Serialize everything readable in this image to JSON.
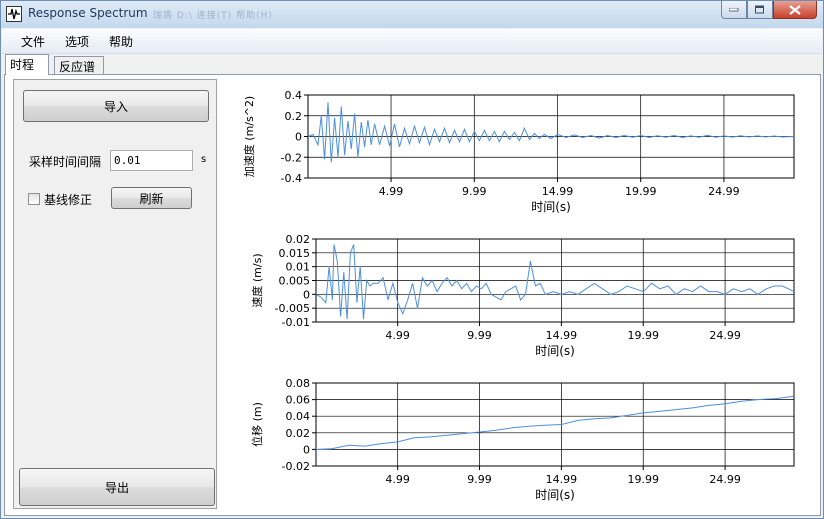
{
  "window": {
    "title": "Response Spectrum",
    "ghost_title": "瑞盾 D:\\  连接(T)  帮助(H)"
  },
  "menu": [
    "文件",
    "选项",
    "帮助"
  ],
  "tabs": [
    "时程",
    "反应谱"
  ],
  "left_panel": {
    "import_button": "导入",
    "interval_label": "采样时间间隔",
    "interval_value": "0.01",
    "interval_unit": "s",
    "baseline_label": "基线修正",
    "baseline_checked": false,
    "refresh_button": "刷新",
    "export_button": "导出"
  },
  "colors": {
    "series": "#4d8fdf",
    "grid": "#000000"
  },
  "chart_data": [
    {
      "type": "line",
      "ylabel": "加速度 (m/s^2)",
      "xlabel": "时间(s)",
      "xlim": [
        0,
        29.2
      ],
      "ylim": [
        -0.4,
        0.4
      ],
      "yticks": [
        -0.4,
        -0.2,
        0,
        0.2,
        0.4
      ],
      "ytick_labels": [
        "-0.4",
        "-0.2",
        "0",
        "0.2",
        "0.4"
      ],
      "xticks": [
        4.99,
        9.99,
        14.99,
        19.99,
        24.99
      ],
      "xtick_labels": [
        "4.99",
        "9.99",
        "14.99",
        "19.99",
        "24.99"
      ],
      "series": [
        {
          "x": [
            0,
            0.3,
            0.6,
            0.8,
            1.0,
            1.2,
            1.4,
            1.6,
            1.8,
            2.0,
            2.2,
            2.4,
            2.6,
            2.8,
            3.0,
            3.2,
            3.4,
            3.6,
            3.8,
            4.0,
            4.3,
            4.6,
            4.9,
            5.2,
            5.5,
            5.8,
            6.1,
            6.4,
            6.7,
            7.0,
            7.3,
            7.6,
            7.9,
            8.2,
            8.5,
            8.8,
            9.1,
            9.4,
            9.7,
            10.0,
            10.3,
            10.6,
            10.9,
            11.2,
            11.5,
            11.8,
            12.1,
            12.4,
            12.7,
            13.0,
            13.3,
            13.6,
            13.9,
            14.2,
            14.6,
            15.0,
            15.5,
            16.0,
            16.5,
            17.0,
            17.5,
            18.0,
            18.5,
            19.0,
            19.5,
            20.0,
            20.5,
            21.0,
            21.5,
            22.0,
            22.5,
            23.0,
            23.5,
            24.0,
            24.5,
            25.0,
            25.5,
            26.0,
            26.5,
            27.0,
            27.5,
            28.0,
            28.5,
            29.2
          ],
          "y": [
            0,
            0.02,
            -0.08,
            0.2,
            -0.22,
            0.33,
            -0.25,
            0.18,
            -0.2,
            0.29,
            -0.18,
            0.15,
            -0.12,
            0.22,
            -0.2,
            0.14,
            -0.1,
            0.16,
            -0.08,
            0.12,
            -0.08,
            0.1,
            -0.09,
            0.12,
            -0.1,
            0.08,
            -0.07,
            0.1,
            -0.06,
            0.09,
            -0.08,
            0.07,
            -0.05,
            0.08,
            -0.06,
            0.06,
            -0.05,
            0.07,
            -0.05,
            0.05,
            -0.04,
            0.06,
            -0.04,
            0.05,
            -0.05,
            0.05,
            -0.03,
            0.04,
            -0.04,
            0.08,
            -0.03,
            0.03,
            -0.02,
            0.02,
            -0.02,
            0.02,
            -0.01,
            0.015,
            -0.01,
            0.01,
            -0.015,
            0.01,
            -0.01,
            0.01,
            -0.008,
            0.01,
            -0.01,
            0.008,
            -0.008,
            0.01,
            -0.01,
            0.006,
            -0.008,
            0.012,
            -0.008,
            0.006,
            -0.006,
            0.008,
            -0.005,
            0.006,
            -0.005,
            0.005,
            -0.005,
            0
          ]
        }
      ]
    },
    {
      "type": "line",
      "ylabel": "速度 (m/s)",
      "xlabel": "时间(s)",
      "xlim": [
        0,
        29.2
      ],
      "ylim": [
        -0.01,
        0.02
      ],
      "yticks": [
        -0.01,
        -0.005,
        0,
        0.005,
        0.01,
        0.015,
        0.02
      ],
      "ytick_labels": [
        "-0.01",
        "-0.005",
        "0",
        "0.005",
        "0.01",
        "0.015",
        "0.02"
      ],
      "xticks": [
        4.99,
        9.99,
        14.99,
        19.99,
        24.99
      ],
      "xtick_labels": [
        "4.99",
        "9.99",
        "14.99",
        "19.99",
        "24.99"
      ],
      "series": [
        {
          "x": [
            0,
            0.3,
            0.6,
            0.8,
            1.0,
            1.1,
            1.3,
            1.5,
            1.7,
            1.9,
            2.1,
            2.3,
            2.5,
            2.7,
            2.9,
            3.1,
            3.3,
            3.5,
            3.8,
            4.1,
            4.4,
            4.7,
            5.0,
            5.3,
            5.6,
            5.9,
            6.2,
            6.5,
            6.8,
            7.1,
            7.4,
            7.7,
            8.0,
            8.3,
            8.6,
            8.9,
            9.2,
            9.5,
            9.8,
            10.1,
            10.4,
            10.7,
            11.0,
            11.3,
            11.6,
            11.9,
            12.2,
            12.5,
            12.8,
            13.1,
            13.4,
            13.7,
            14.0,
            14.5,
            15.0,
            15.5,
            16.0,
            16.5,
            17.0,
            17.5,
            18.0,
            18.5,
            19.0,
            19.5,
            20.0,
            20.5,
            21.0,
            21.5,
            22.0,
            22.5,
            23.0,
            23.5,
            24.0,
            24.5,
            25.0,
            25.5,
            26.0,
            26.5,
            27.0,
            27.5,
            28.0,
            28.5,
            29.2
          ],
          "y": [
            0,
            -0.001,
            -0.003,
            0.01,
            -0.002,
            0.018,
            0.012,
            -0.008,
            0.008,
            -0.009,
            0.015,
            0.018,
            -0.003,
            0.01,
            -0.009,
            0.005,
            0.003,
            0.004,
            0.004,
            0.006,
            -0.002,
            0.004,
            -0.003,
            -0.007,
            -0.002,
            0.004,
            -0.005,
            0.006,
            0.003,
            0.005,
            0.001,
            0.004,
            0.006,
            0.003,
            0.005,
            0.002,
            0.004,
            0.001,
            0.003,
            0.002,
            0.004,
            0.0,
            -0.001,
            -0.002,
            0.001,
            0.002,
            0.003,
            -0.002,
            0.0,
            0.012,
            0.003,
            0.004,
            0.0,
            0.001,
            0.0,
            0.001,
            0.0,
            0.002,
            0.004,
            0.002,
            0.0,
            0.001,
            0.003,
            0.002,
            0.001,
            0.004,
            0.002,
            0.003,
            0.0,
            0.002,
            0.001,
            0.003,
            0.001,
            0.001,
            0.0,
            0.002,
            0.001,
            0.002,
            0.0,
            0.002,
            0.003,
            0.003,
            0.001
          ]
        }
      ]
    },
    {
      "type": "line",
      "ylabel": "位移 (m)",
      "xlabel": "时间(s)",
      "xlim": [
        0,
        29.2
      ],
      "ylim": [
        -0.02,
        0.08
      ],
      "yticks": [
        -0.02,
        0,
        0.02,
        0.04,
        0.06,
        0.08
      ],
      "ytick_labels": [
        "-0.02",
        "0",
        "0.02",
        "0.04",
        "0.06",
        "0.08"
      ],
      "xticks": [
        4.99,
        9.99,
        14.99,
        19.99,
        24.99
      ],
      "xtick_labels": [
        "4.99",
        "9.99",
        "14.99",
        "19.99",
        "24.99"
      ],
      "series": [
        {
          "x": [
            0,
            1,
            2,
            3,
            4,
            5,
            6,
            7,
            8,
            9,
            10,
            11,
            12,
            13,
            14,
            15,
            16,
            17,
            18,
            19,
            20,
            21,
            22,
            23,
            24,
            25,
            26,
            27,
            28,
            29.2
          ],
          "y": [
            0,
            0.001,
            0.005,
            0.004,
            0.007,
            0.009,
            0.014,
            0.015,
            0.017,
            0.019,
            0.021,
            0.023,
            0.026,
            0.028,
            0.029,
            0.03,
            0.035,
            0.037,
            0.038,
            0.041,
            0.044,
            0.046,
            0.048,
            0.05,
            0.053,
            0.055,
            0.058,
            0.06,
            0.061,
            0.064
          ]
        }
      ]
    }
  ]
}
